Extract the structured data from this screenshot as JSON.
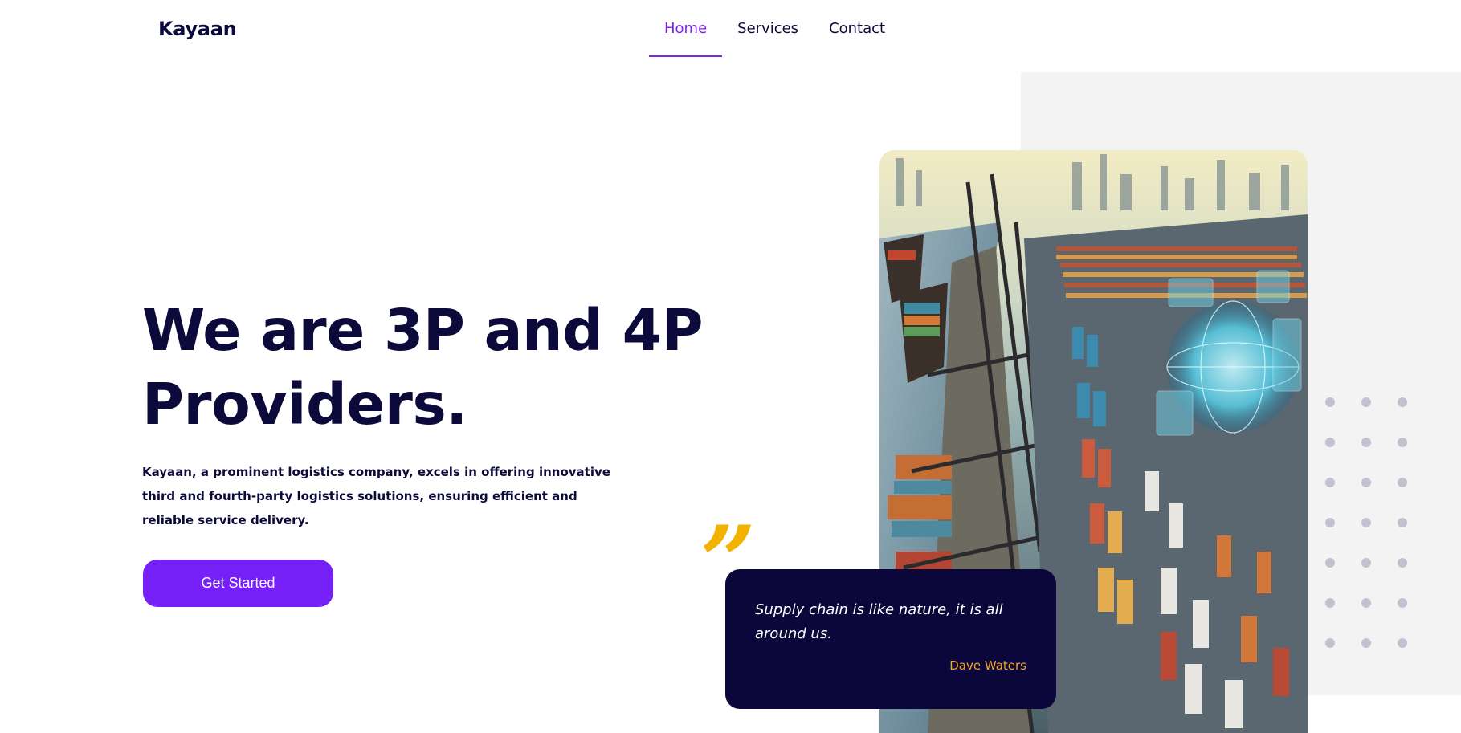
{
  "brand": {
    "name": "Kayaan"
  },
  "nav": {
    "items": [
      {
        "label": "Home",
        "active": true
      },
      {
        "label": "Services",
        "active": false
      },
      {
        "label": "Contact",
        "active": false
      }
    ]
  },
  "hero": {
    "title": "We are 3P and 4P Providers.",
    "description": "Kayaan, a prominent logistics company, excels in offering innovative third and fourth-party logistics solutions, ensuring efficient and reliable service delivery.",
    "cta_label": "Get Started"
  },
  "quote": {
    "mark": "”",
    "text": "Supply chain is like nature, it is all around us.",
    "author": "Dave Waters"
  },
  "colors": {
    "primary": "#7420f7",
    "nav_active": "#7f22f0",
    "navy": "#0c0a3a",
    "quote_card": "#0c073a",
    "quote_mark": "#f2b300",
    "author": "#f2a52b",
    "panel": "#f3f3f3",
    "dots": "#c3c1cf"
  }
}
